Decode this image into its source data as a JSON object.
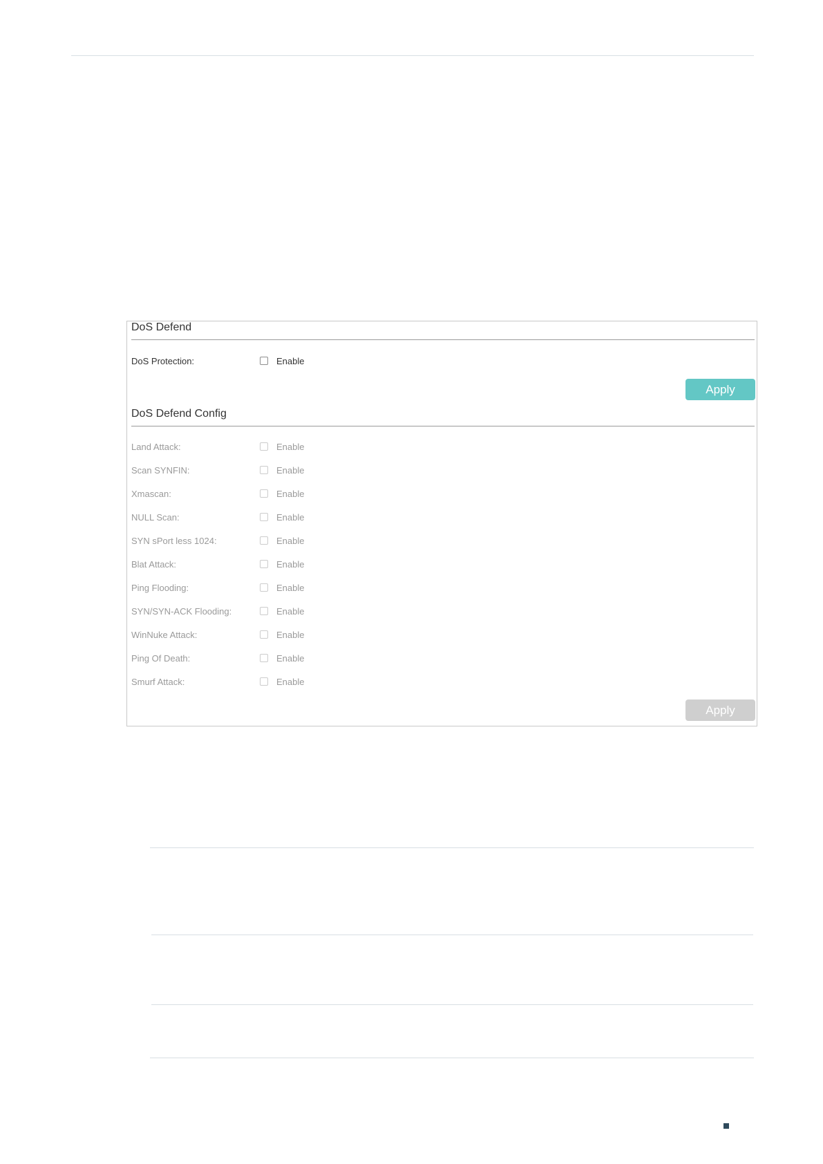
{
  "dos_defend": {
    "title": "DoS Defend",
    "protection": {
      "label": "DoS Protection:",
      "option": "Enable",
      "checked": false
    },
    "apply_label": "Apply",
    "apply_color": "#63c7c5"
  },
  "dos_defend_config": {
    "title": "DoS Defend Config",
    "items": [
      {
        "label": "Land Attack:",
        "option": "Enable",
        "checked": false
      },
      {
        "label": "Scan SYNFIN:",
        "option": "Enable",
        "checked": false
      },
      {
        "label": "Xmascan:",
        "option": "Enable",
        "checked": false
      },
      {
        "label": "NULL Scan:",
        "option": "Enable",
        "checked": false
      },
      {
        "label": "SYN sPort less 1024:",
        "option": "Enable",
        "checked": false
      },
      {
        "label": "Blat Attack:",
        "option": "Enable",
        "checked": false
      },
      {
        "label": "Ping Flooding:",
        "option": "Enable",
        "checked": false
      },
      {
        "label": "SYN/SYN-ACK Flooding:",
        "option": "Enable",
        "checked": false
      },
      {
        "label": "WinNuke Attack:",
        "option": "Enable",
        "checked": false
      },
      {
        "label": "Ping Of Death:",
        "option": "Enable",
        "checked": false
      },
      {
        "label": "Smurf Attack:",
        "option": "Enable",
        "checked": false
      }
    ],
    "apply_label": "Apply",
    "apply_color": "#cfcfcf"
  }
}
